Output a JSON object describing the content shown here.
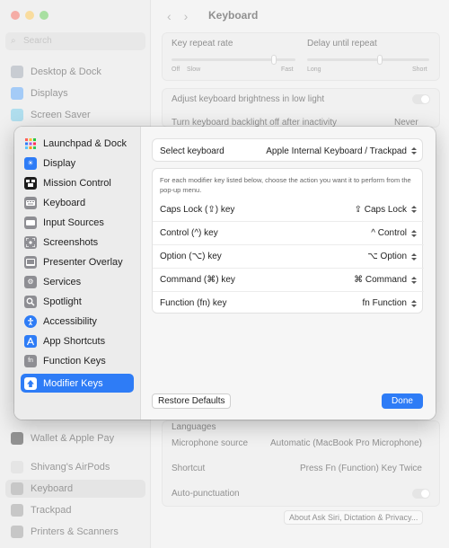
{
  "background": {
    "search_placeholder": "Search",
    "sidebar_items": [
      "Desktop & Dock",
      "Displays",
      "Screen Saver",
      "Wallet & Apple Pay",
      "Shivang's AirPods",
      "Keyboard",
      "Trackpad",
      "Printers & Scanners"
    ],
    "title": "Keyboard",
    "key_repeat_rate": "Key repeat rate",
    "delay_until_repeat": "Delay until repeat",
    "repeat_scale": [
      "Off",
      "Slow",
      "Fast"
    ],
    "delay_scale": [
      "Long",
      "Short"
    ],
    "brightness_low_light": "Adjust keyboard brightness in low light",
    "backlight_off": "Turn keyboard backlight off after inactivity",
    "backlight_off_value": "Never",
    "languages": "Languages",
    "microphone_source": "Microphone source",
    "microphone_value": "Automatic (MacBook Pro Microphone)",
    "shortcut": "Shortcut",
    "shortcut_value": "Press Fn (Function) Key Twice",
    "auto_punctuation": "Auto-punctuation",
    "about_siri": "About Ask Siri, Dictation & Privacy..."
  },
  "sheet": {
    "sidebar": [
      {
        "label": "Launchpad & Dock",
        "icon": "launchpad-icon",
        "color": "#ffffff"
      },
      {
        "label": "Display",
        "icon": "display-icon",
        "color": "#2e7cf6"
      },
      {
        "label": "Mission Control",
        "icon": "mission-control-icon",
        "color": "#1c1c1c"
      },
      {
        "label": "Keyboard",
        "icon": "keyboard-icon",
        "color": "#8e8e93"
      },
      {
        "label": "Input Sources",
        "icon": "input-sources-icon",
        "color": "#8e8e93"
      },
      {
        "label": "Screenshots",
        "icon": "screenshots-icon",
        "color": "#8e8e93"
      },
      {
        "label": "Presenter Overlay",
        "icon": "presenter-overlay-icon",
        "color": "#8e8e93"
      },
      {
        "label": "Services",
        "icon": "services-icon",
        "color": "#8e8e93"
      },
      {
        "label": "Spotlight",
        "icon": "spotlight-icon",
        "color": "#8e8e93"
      },
      {
        "label": "Accessibility",
        "icon": "accessibility-icon",
        "color": "#2e7cf6"
      },
      {
        "label": "App Shortcuts",
        "icon": "app-shortcuts-icon",
        "color": "#2e7cf6"
      },
      {
        "label": "Function Keys",
        "icon": "function-keys-icon",
        "color": "#8e8e93"
      },
      {
        "label": "Modifier Keys",
        "icon": "modifier-keys-icon",
        "color": "#ffffff"
      }
    ],
    "select_keyboard_label": "Select keyboard",
    "select_keyboard_value": "Apple Internal Keyboard / Trackpad",
    "description": "For each modifier key listed below, choose the action you want it to perform from the pop-up menu.",
    "modifiers": [
      {
        "label": "Caps Lock (⇪) key",
        "value": "⇪ Caps Lock"
      },
      {
        "label": "Control (^) key",
        "value": "^ Control"
      },
      {
        "label": "Option (⌥) key",
        "value": "⌥ Option"
      },
      {
        "label": "Command (⌘) key",
        "value": "⌘ Command"
      },
      {
        "label": "Function (fn) key",
        "value": "fn Function"
      }
    ],
    "restore_defaults": "Restore Defaults",
    "done": "Done"
  },
  "colors": {
    "accent": "#2e7cf6"
  }
}
